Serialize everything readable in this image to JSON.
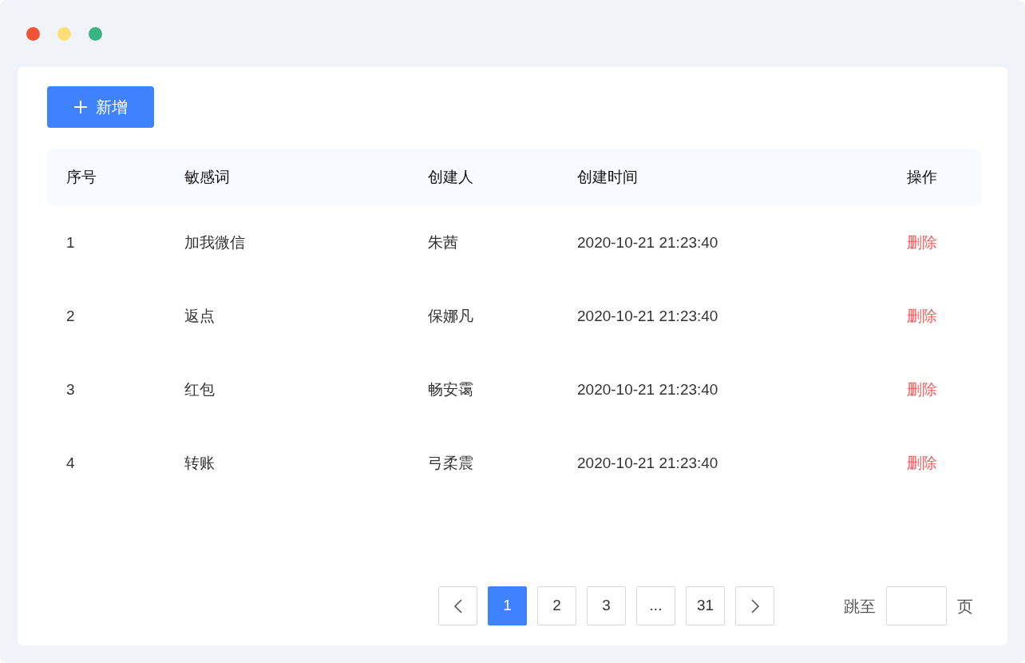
{
  "window": {
    "controls": [
      {
        "color": "#ee5535"
      },
      {
        "color": "#fedf75"
      },
      {
        "color": "#37b47f"
      }
    ]
  },
  "add_button": {
    "label": "新增"
  },
  "table": {
    "columns": [
      "序号",
      "敏感词",
      "创建人",
      "创建时间",
      "操作"
    ],
    "rows": [
      {
        "index": "1",
        "word": "加我微信",
        "creator": "朱茜",
        "created_at": "2020-10-21 21:23:40",
        "action": "删除"
      },
      {
        "index": "2",
        "word": "返点",
        "creator": "保娜凡",
        "created_at": "2020-10-21 21:23:40",
        "action": "删除"
      },
      {
        "index": "3",
        "word": "红包",
        "creator": "畅安霭",
        "created_at": "2020-10-21 21:23:40",
        "action": "删除"
      },
      {
        "index": "4",
        "word": "转账",
        "creator": "弓柔震",
        "created_at": "2020-10-21 21:23:40",
        "action": "删除"
      }
    ]
  },
  "pagination": {
    "pages": [
      {
        "kind": "prev",
        "selected": false
      },
      {
        "kind": "page",
        "label": "1",
        "selected": true
      },
      {
        "kind": "page",
        "label": "2",
        "selected": false
      },
      {
        "kind": "page",
        "label": "3",
        "selected": false
      },
      {
        "kind": "ellipsis",
        "label": "...",
        "selected": false
      },
      {
        "kind": "page",
        "label": "31",
        "selected": false
      },
      {
        "kind": "next",
        "selected": false
      }
    ],
    "jump_label": "跳至",
    "jump_suffix": "页"
  }
}
